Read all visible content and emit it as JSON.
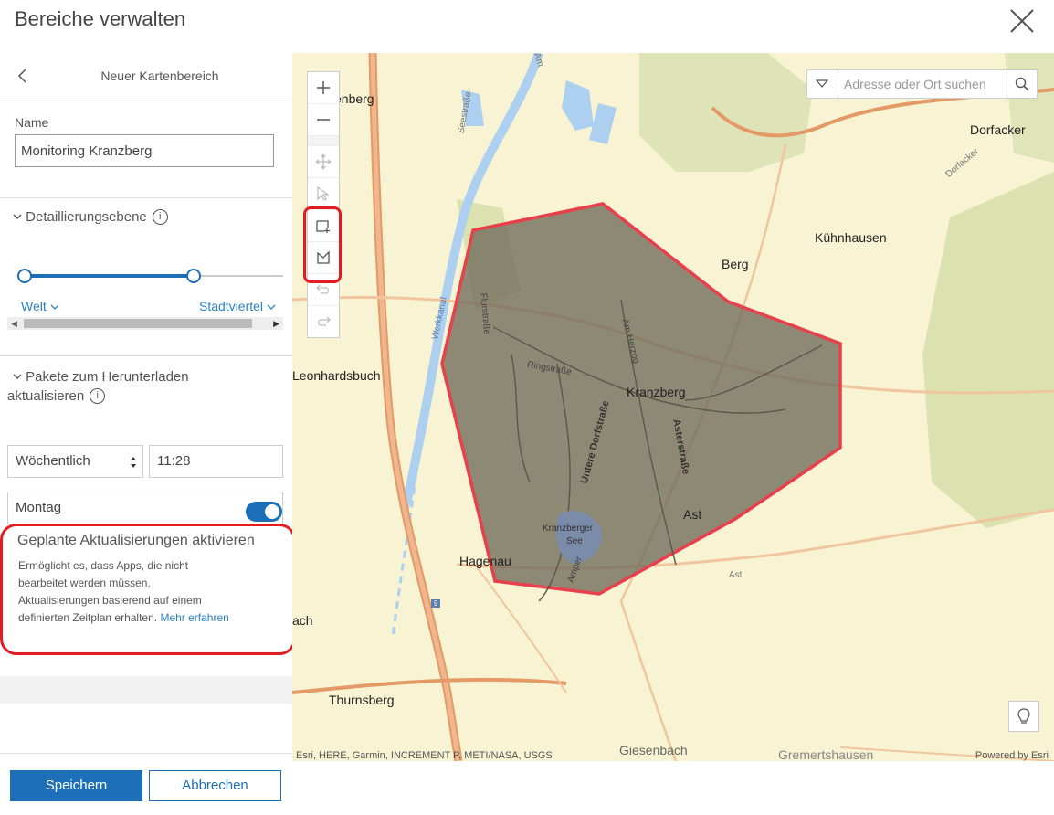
{
  "dialog": {
    "title": "Bereiche verwalten",
    "close_icon": "close-icon"
  },
  "nav": {
    "title": "Neuer Kartenbereich",
    "back_icon": "chevron-left-icon"
  },
  "name_section": {
    "label": "Name",
    "value": "Monitoring Kranzberg"
  },
  "detail_section": {
    "title": "Detaillierungsebene",
    "min_label": "Welt",
    "max_label": "Stadtviertel",
    "range": {
      "min_fraction": 0.0,
      "max_fraction": 0.65
    }
  },
  "packages_section": {
    "title_line1": "Pakete zum Herunterladen",
    "title_line2": "aktualisieren",
    "frequency": "Wöchentlich",
    "time": "11:28",
    "day": "Montag"
  },
  "scheduled": {
    "title": "Geplante Aktualisierungen aktivieren",
    "desc_line1": "Ermöglicht es, dass Apps, die nicht",
    "desc_line2": "bearbeitet werden müssen,",
    "desc_line3": "Aktualisierungen basierend auf einem",
    "desc_line4": "definierten Zeitplan erhalten.",
    "learn_more": "Mehr erfahren",
    "enabled": true
  },
  "footer": {
    "save_label": "Speichern",
    "cancel_label": "Abbrechen"
  },
  "map": {
    "search_placeholder": "Adresse oder Ort suchen",
    "attribution": "Esri, HERE, Garmin, INCREMENT P, METI/NASA, USGS",
    "powered_by": "Powered by Esri",
    "places": {
      "p1": "enberg",
      "p2": "Dorfacker",
      "p3": "Kühnhausen",
      "p4": "Berg",
      "p5": "Leonhardsbuch",
      "p6": "Kranzberg",
      "p7": "Ast",
      "p8": "Hagenau",
      "p9": "ach",
      "p10": "Thurnsberg",
      "p11": "Giesenbach",
      "p12": "Gremertshausen"
    },
    "streets": {
      "s1": "Seestraße",
      "s2": "Werkkanal",
      "s3": "Flurstraße",
      "s4": "Ringstraße",
      "s5": "Am Herzog",
      "s6": "Untere Dorfstraße",
      "s7": "Asterstraße",
      "s8": "Kranzberger",
      "s9": "See",
      "s10": "Amper",
      "s11": "Dorfacker",
      "s12": "Ast",
      "s13": "Am",
      "s14": "9"
    },
    "colors": {
      "polygon_fill": "#6f6a5a",
      "polygon_stroke": "#e8404a",
      "highlight": "#e31b23",
      "accent": "#1d6fb8"
    }
  }
}
